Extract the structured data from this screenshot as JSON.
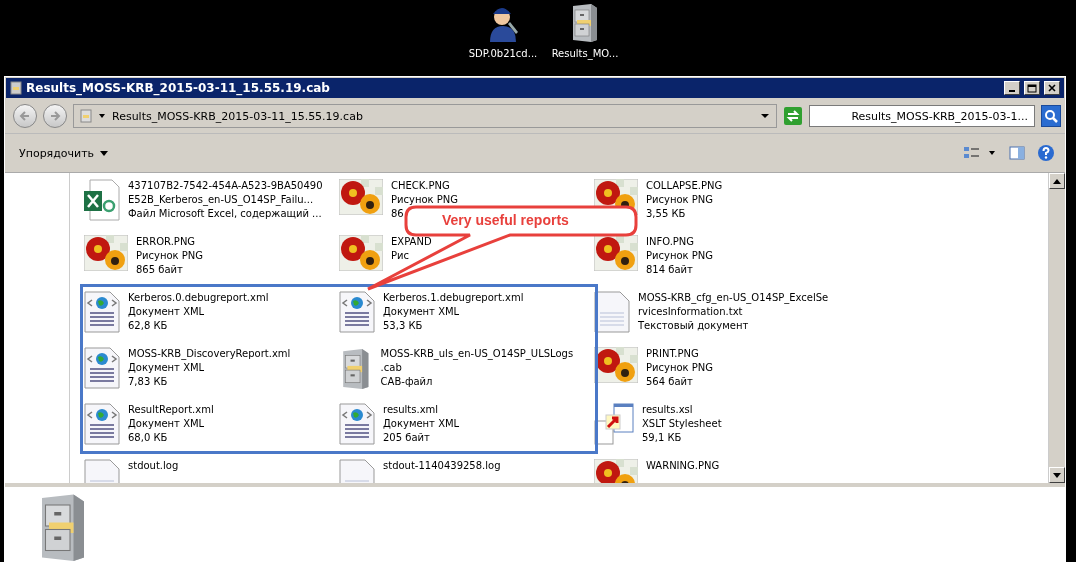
{
  "desktop_icons": [
    {
      "kind": "technician",
      "label": "SDP.0b21cd..."
    },
    {
      "kind": "cabinet",
      "label": "Results_MO..."
    }
  ],
  "window": {
    "title": "Results_MOSS-KRB_2015-03-11_15.55.19.cab"
  },
  "address_bar": {
    "path": "Results_MOSS-KRB_2015-03-11_15.55.19.cab",
    "search_value": "Results_MOSS-KRB_2015-03-1..."
  },
  "toolbar": {
    "organize": "Упорядочить"
  },
  "files": [
    {
      "kind": "excel",
      "lines": [
        "437107B2-7542-454A-A523-9BA50490",
        "E52B_Kerberos_en-US_O14SP_Failu...",
        "Файл Microsoft Excel, содержащий ..."
      ]
    },
    {
      "kind": "image",
      "lines": [
        "CHECK.PNG",
        "Рисунок PNG",
        "86"
      ]
    },
    {
      "kind": "image",
      "lines": [
        "COLLAPSE.PNG",
        "Рисунок PNG",
        "3,55 КБ"
      ]
    },
    {
      "kind": "image",
      "lines": [
        "ERROR.PNG",
        "Рисунок PNG",
        "865 байт"
      ]
    },
    {
      "kind": "image",
      "lines": [
        "EXPAND",
        "Рис"
      ]
    },
    {
      "kind": "image",
      "lines": [
        "INFO.PNG",
        "Рисунок PNG",
        "814 байт"
      ]
    },
    {
      "kind": "xml",
      "lines": [
        "Kerberos.0.debugreport.xml",
        "Документ XML",
        "62,8 КБ"
      ]
    },
    {
      "kind": "xml",
      "lines": [
        "Kerberos.1.debugreport.xml",
        "Документ XML",
        "53,3 КБ"
      ]
    },
    {
      "kind": "text",
      "lines": [
        "MOSS-KRB_cfg_en-US_O14SP_ExcelSe",
        "rvicesInformation.txt",
        "Текстовый документ"
      ]
    },
    {
      "kind": "xml",
      "lines": [
        "MOSS-KRB_DiscoveryReport.xml",
        "Документ XML",
        "7,83 КБ"
      ]
    },
    {
      "kind": "cabinet",
      "lines": [
        "MOSS-KRB_uls_en-US_O14SP_ULSLogs",
        ".cab",
        "CAB-файл"
      ]
    },
    {
      "kind": "image",
      "lines": [
        "PRINT.PNG",
        "Рисунок PNG",
        "564 байт"
      ]
    },
    {
      "kind": "xml",
      "lines": [
        "ResultReport.xml",
        "Документ XML",
        "68,0 КБ"
      ]
    },
    {
      "kind": "xml",
      "lines": [
        "results.xml",
        "Документ XML",
        "205 байт"
      ]
    },
    {
      "kind": "xsl",
      "lines": [
        "results.xsl",
        "XSLT Stylesheet",
        "59,1 КБ"
      ]
    },
    {
      "kind": "text",
      "lines": [
        "stdout.log"
      ]
    },
    {
      "kind": "text",
      "lines": [
        "stdout-1140439258.log"
      ]
    },
    {
      "kind": "image",
      "lines": [
        "WARNING.PNG"
      ]
    }
  ],
  "callout": {
    "text": "Very useful reports"
  },
  "details_pane": {
    "kind": "cabinet"
  }
}
